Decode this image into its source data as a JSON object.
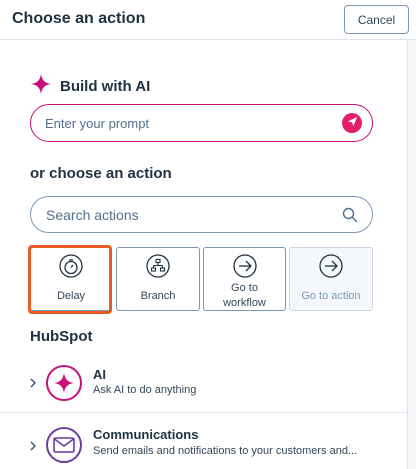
{
  "header": {
    "title": "Choose an action",
    "cancel_label": "Cancel"
  },
  "ai_section": {
    "title": "Build with AI",
    "prompt_placeholder": "Enter your prompt"
  },
  "actions_section": {
    "title": "or choose an action",
    "search_placeholder": "Search actions",
    "tiles": [
      {
        "label": "Delay",
        "icon": "stopwatch-icon",
        "highlighted": true,
        "disabled": false
      },
      {
        "label": "Branch",
        "icon": "branch-icon",
        "highlighted": false,
        "disabled": false
      },
      {
        "label": "Go to workflow",
        "icon": "arrow-circle-icon",
        "highlighted": false,
        "disabled": false
      },
      {
        "label": "Go to action",
        "icon": "arrow-circle-icon",
        "highlighted": false,
        "disabled": true
      }
    ]
  },
  "hubspot_section": {
    "title": "HubSpot",
    "items": [
      {
        "title": "AI",
        "description": "Ask AI to do anything",
        "icon": "sparkle-icon"
      },
      {
        "title": "Communications",
        "description": "Send emails and notifications to your customers and...",
        "icon": "envelope-icon"
      }
    ]
  },
  "colors": {
    "ai_accent": "#c7107a",
    "send_button": "#e31e6b",
    "highlight": "#ea5b26",
    "communications_accent": "#6a3ea1"
  }
}
